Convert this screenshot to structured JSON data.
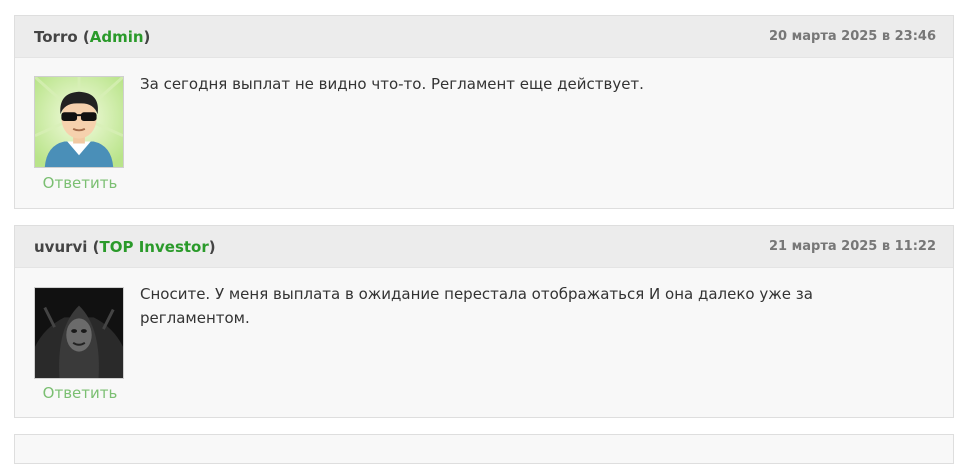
{
  "comments": [
    {
      "author": "Torro",
      "role": "Admin",
      "date": "20 марта 2025 в 23:46",
      "text": "За сегодня выплат не видно что-то. Регламент еще действует.",
      "reply_label": "Ответить",
      "avatar_icon": "cartoon-man-sunglasses-icon"
    },
    {
      "author": "uvurvi",
      "role": "TOP Investor",
      "date": "21 марта 2025 в 11:22",
      "text": "Сносите. У меня выплата в ожидание перестала отображаться И она далеко уже за регламентом.",
      "reply_label": "Ответить",
      "avatar_icon": "dark-hooded-figure-icon"
    }
  ],
  "colors": {
    "role": "#2a9a2a",
    "reply": "#7bbf72",
    "header_bg": "#ececec",
    "body_bg": "#f8f8f8"
  }
}
